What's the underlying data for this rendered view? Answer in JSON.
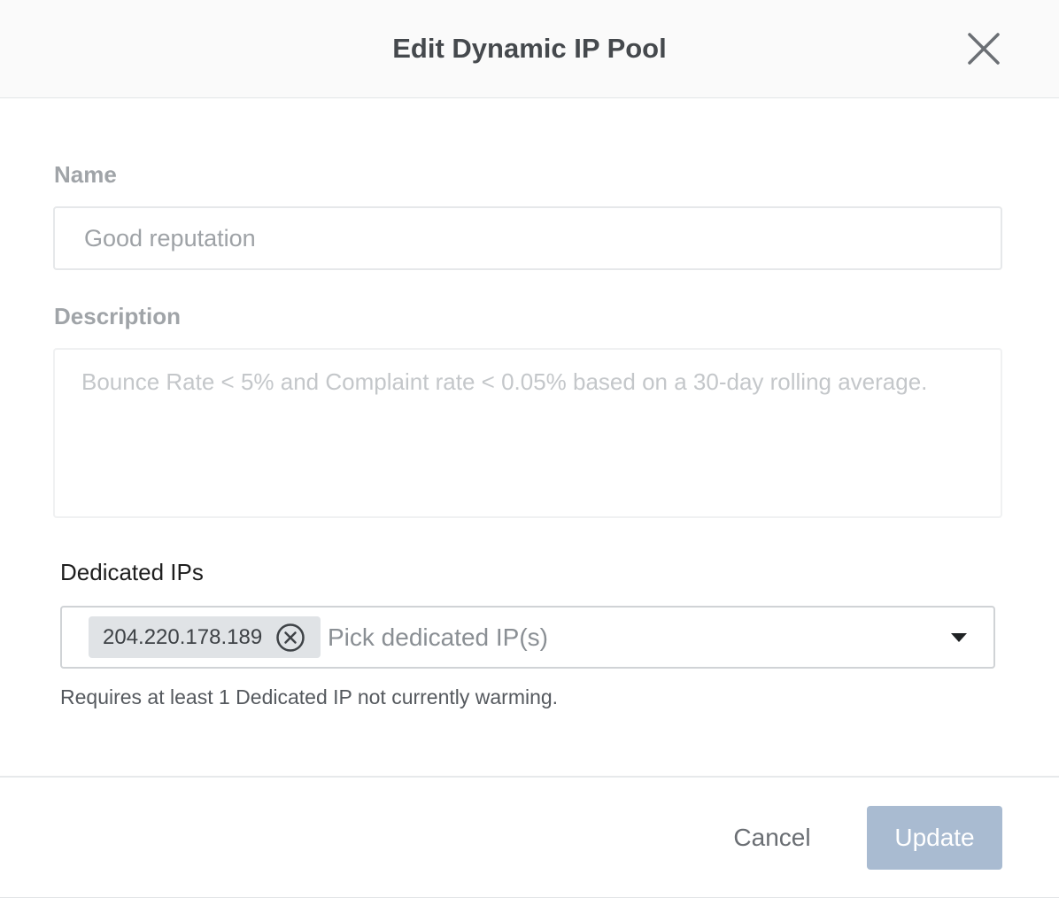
{
  "dialog": {
    "title": "Edit Dynamic IP Pool",
    "close_icon": "close-icon"
  },
  "form": {
    "name": {
      "label": "Name",
      "value": "Good reputation"
    },
    "description": {
      "label": "Description",
      "value": "Bounce Rate < 5% and Complaint rate < 0.05% based on a 30-day rolling average."
    },
    "dedicated_ips": {
      "label": "Dedicated IPs",
      "selected": [
        "204.220.178.189"
      ],
      "placeholder": "Pick dedicated IP(s)",
      "helper": "Requires at least 1 Dedicated IP not currently warming."
    }
  },
  "footer": {
    "cancel_label": "Cancel",
    "update_label": "Update"
  },
  "colors": {
    "update_button": "#a9bbd1",
    "chip_bg": "#e0e3e6"
  }
}
